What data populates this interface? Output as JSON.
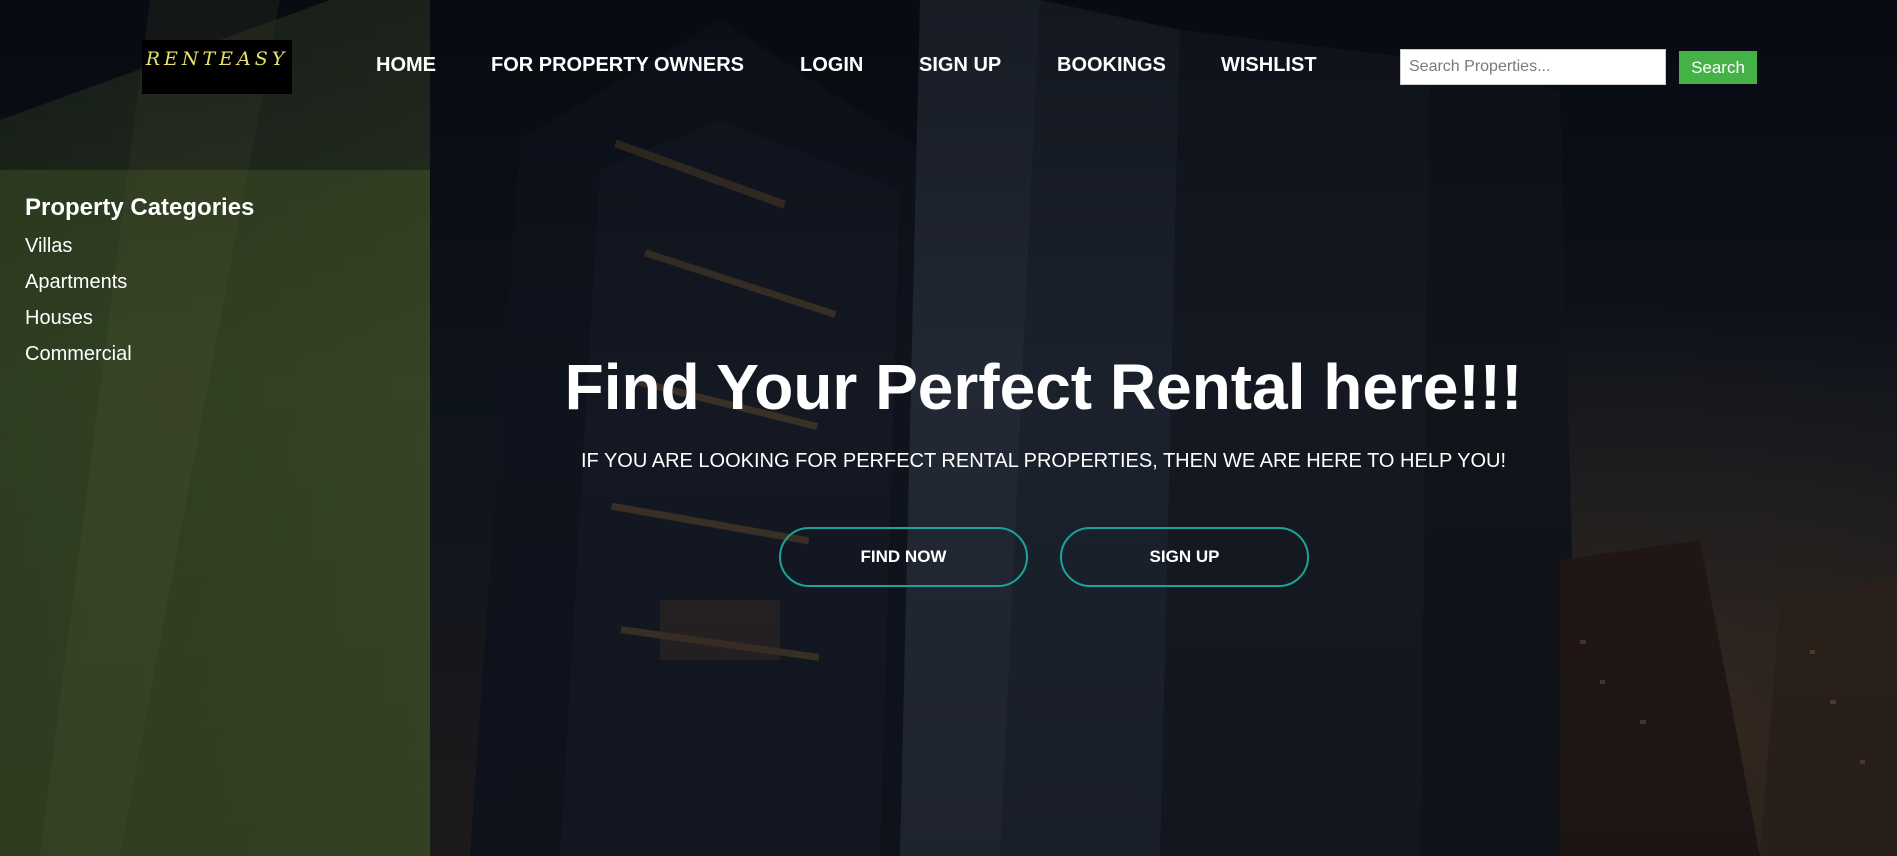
{
  "brand": {
    "logo_text": "RENTEASY"
  },
  "nav": {
    "items": [
      {
        "label": "HOME"
      },
      {
        "label": "FOR PROPERTY OWNERS"
      },
      {
        "label": "LOGIN"
      },
      {
        "label": "SIGN UP"
      },
      {
        "label": "BOOKINGS"
      },
      {
        "label": "WISHLIST"
      }
    ]
  },
  "search": {
    "placeholder": "Search Properties...",
    "value": "",
    "button_label": "Search"
  },
  "sidebar": {
    "title": "Property Categories",
    "items": [
      {
        "label": "Villas"
      },
      {
        "label": "Apartments"
      },
      {
        "label": "Houses"
      },
      {
        "label": "Commercial"
      }
    ]
  },
  "hero": {
    "title": "Find Your Perfect Rental here!!!",
    "subtitle": "IF YOU ARE LOOKING FOR PERFECT RENTAL PROPERTIES, THEN WE ARE HERE TO HELP YOU!",
    "buttons": {
      "find_now": "FIND NOW",
      "sign_up": "SIGN UP"
    }
  },
  "colors": {
    "search_button": "#45b248",
    "hero_button_border": "#1aa39a",
    "logo_text": "#e8e06a"
  }
}
